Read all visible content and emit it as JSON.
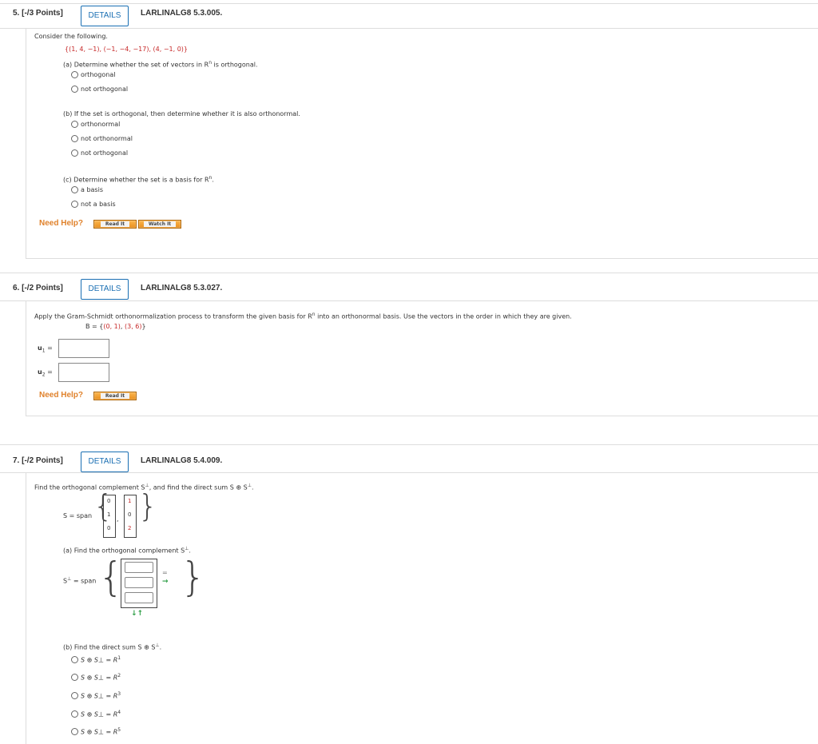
{
  "q5": {
    "number": "5.",
    "points": "[-/3 Points]",
    "details": "DETAILS",
    "code": "LARLINALG8 5.3.005.",
    "prompt": "Consider the following.",
    "set": "{(1, 4, −1), (−1, −4, −17), (4, −1, 0)}",
    "part_a": "(a) Determine whether the set of vectors in R",
    "part_a_sup": "n",
    "part_a_end": " is orthogonal.",
    "a_options": [
      "orthogonal",
      "not orthogonal"
    ],
    "part_b": "(b) If the set is orthogonal, then determine whether it is also orthonormal.",
    "b_options": [
      "orthonormal",
      "not orthonormal",
      "not orthogonal"
    ],
    "part_c": "(c) Determine whether the set is a basis for R",
    "part_c_sup": "n",
    "part_c_end": ".",
    "c_options": [
      "a basis",
      "not a basis"
    ],
    "need_help": "Need Help?",
    "read_it": "Read It",
    "watch_it": "Watch It"
  },
  "q6": {
    "number": "6.",
    "points": "[-/2 Points]",
    "details": "DETAILS",
    "code": "LARLINALG8 5.3.027.",
    "prompt": "Apply the Gram-Schmidt orthonormalization process to transform the given basis for R",
    "prompt_sup": "n",
    "prompt_end": " into an orthonormal basis. Use the vectors in the order in which they are given.",
    "basis_label": "B = {",
    "basis_v1": "(0, 1)",
    "basis_sep": ", ",
    "basis_v2": "(3, 6)",
    "basis_close": "}",
    "u1_label": "u",
    "u1_sub": "1",
    "u2_label": "u",
    "u2_sub": "2",
    "eq": "=",
    "need_help": "Need Help?",
    "read_it": "Read It"
  },
  "q7": {
    "number": "7.",
    "points": "[-/2 Points]",
    "details": "DETAILS",
    "code": "LARLINALG8 5.4.009.",
    "prompt": "Find the orthogonal complement S",
    "prompt_mid": ", and find the direct sum S ⊕ S",
    "prompt_end": ".",
    "perp": "⊥",
    "s_span": "S = span",
    "matrix1": [
      "0",
      "1",
      "0"
    ],
    "matrix2": [
      "1",
      "0",
      "2"
    ],
    "part_a": "(a) Find the orthogonal complement S",
    "part_a_end": ".",
    "sperp_span": "S",
    "sperp_span_end": " = span",
    "part_b": "(b) Find the direct sum S ⊕ S",
    "part_b_end": ".",
    "b_options": [
      {
        "text": "S ⊕ S⊥ = R",
        "sup": "1"
      },
      {
        "text": "S ⊕ S⊥ = R",
        "sup": "2"
      },
      {
        "text": "S ⊕ S⊥ = R",
        "sup": "3"
      },
      {
        "text": "S ⊕ S⊥ = R",
        "sup": "4"
      },
      {
        "text": "S ⊕ S⊥ = R",
        "sup": "5"
      }
    ]
  },
  "colors": {
    "accent": "#1a6fb3",
    "need_help": "#e0822c",
    "red_value": "#c62828",
    "arrow": "#2e9e46"
  }
}
